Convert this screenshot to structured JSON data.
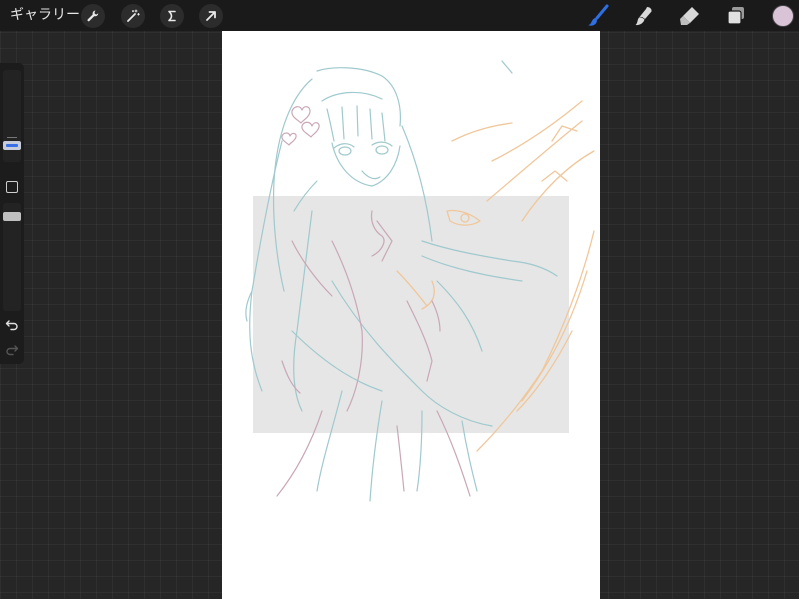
{
  "topbar": {
    "gallery_label": "ギャラリー",
    "left_tools": [
      "wrench-icon",
      "magic-wand-icon",
      "selection-icon",
      "transform-arrow-icon"
    ],
    "right_tools": [
      "brush-icon",
      "smudge-icon",
      "eraser-icon",
      "layers-icon"
    ],
    "active_tool": "brush-icon",
    "accent_color": "#2f6fe4",
    "current_color": "#d8c4d6"
  },
  "sidebar": {
    "items": [
      "brush-size-slider",
      "modify-button",
      "brush-opacity-slider",
      "undo-icon",
      "redo-icon"
    ]
  },
  "canvas": {
    "background": "#ffffff",
    "selection_fill": "#d9d9d9",
    "sketch_colors": [
      "#9fc9cd",
      "#c9a7b6",
      "#f0c79a"
    ]
  }
}
